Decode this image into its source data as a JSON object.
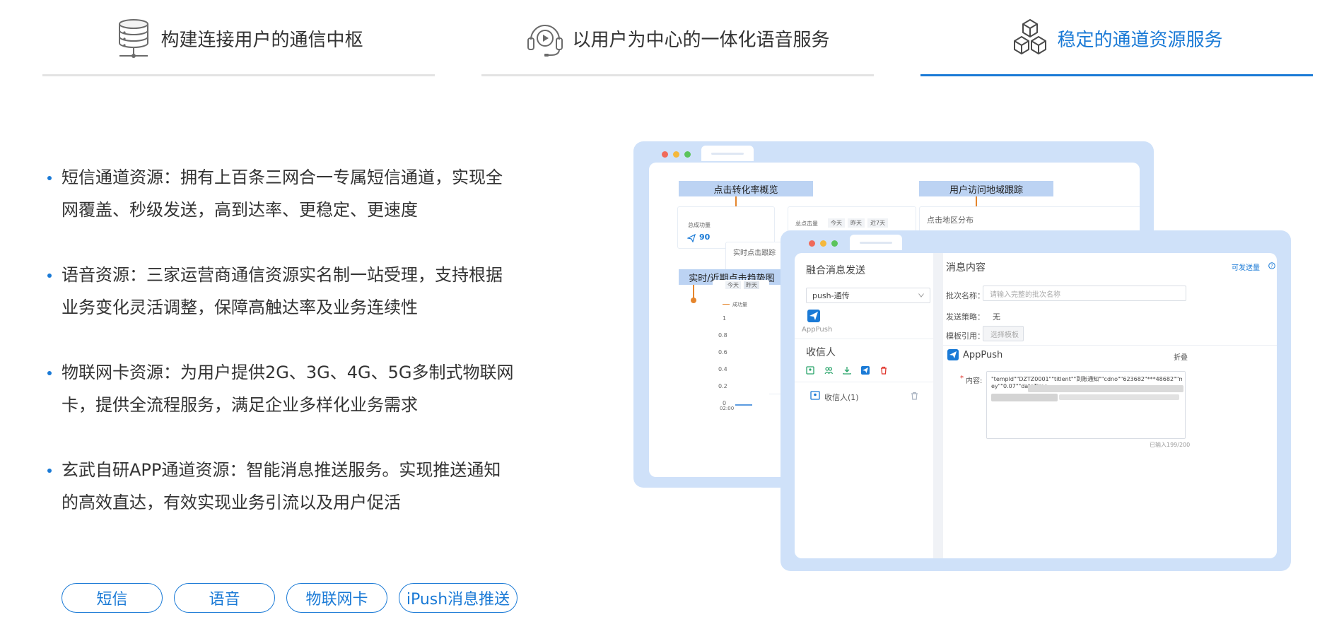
{
  "tabs": [
    {
      "label": "构建连接用户的通信中枢",
      "icon": "database-icon",
      "active": false
    },
    {
      "label": "以用户为中心的一体化语音服务",
      "icon": "headset-icon",
      "active": false
    },
    {
      "label": "稳定的通道资源服务",
      "icon": "cubes-icon",
      "active": true
    }
  ],
  "bullets": [
    {
      "line1": "短信通道资源：拥有上百条三网合一专属短信通道，实现全",
      "line2": "网覆盖、秒级发送，高到达率、更稳定、更速度"
    },
    {
      "line1": "语音资源：三家运营商通信资源实名制一站受理，支持根据",
      "line2": "业务变化灵活调整，保障高触达率及业务连续性"
    },
    {
      "line1": "物联网卡资源：为用户提供2G、3G、4G、5G多制式物联网",
      "line2": "卡，提供全流程服务，满足企业多样化业务需求"
    },
    {
      "line1": "玄武自研APP通道资源：智能消息推送服务。实现推送通知",
      "line2": "的高效直达，有效实现业务引流以及用户促活"
    }
  ],
  "tags": [
    "短信",
    "语音",
    "物联网卡",
    "iPush消息推送"
  ],
  "colors": {
    "accent": "#1a7ad6",
    "window_bg": "#cfe1f9",
    "label_bg": "#bcd3f3",
    "pin": "#e5852c"
  },
  "back_window": {
    "label_conversion": "点击转化率概览",
    "label_region": "用户访问地域跟踪",
    "label_trend": "实时/近期点击趋势图",
    "success_label": "总成功量",
    "success_value": "90",
    "click_label": "总点击量",
    "filters": [
      "今天",
      "昨天",
      "近7天"
    ],
    "region_text": "点击地区分布",
    "realtime_text": "实时点击跟踪",
    "trend_tabs": [
      "今天",
      "昨天"
    ],
    "legend": "成功量",
    "y_ticks": [
      "1",
      "0.8",
      "0.6",
      "0.4",
      "0.2",
      "0"
    ],
    "x_tick": "02:00"
  },
  "front_window": {
    "left_title": "融合消息发送",
    "select_value": "push-通传",
    "app_label": "AppPush",
    "recipient_title": "收信人",
    "recipient_item": "收信人(1)",
    "right_title": "消息内容",
    "right_link": "可发送量",
    "batch_label": "批次名称：",
    "batch_placeholder": "请输入完整的批次名称",
    "strategy_label": "发送策略：",
    "strategy_value": "无",
    "template_label": "模板引用：",
    "template_button": "选择模板",
    "apppush_title": "AppPush",
    "collapse": "折叠",
    "content_label": "内容:",
    "content_text_1": "\"templd\"\"DZTZ0001\"\"titlent\"\"到账通知\"\"cdno\"\"623682\"***48682\"\"mon",
    "content_text_2": "ey\"\"0.07\"\"dateTime",
    "counter": "已输入199/200"
  }
}
